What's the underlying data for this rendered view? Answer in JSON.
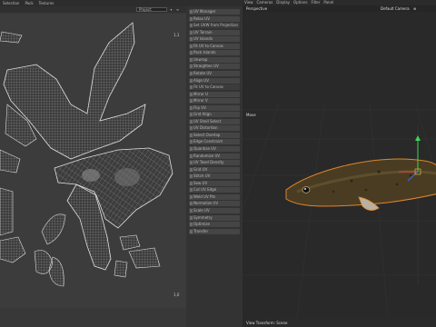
{
  "menubar": {
    "items": [
      "Selection",
      "Pack",
      "Textures"
    ]
  },
  "uv_editor": {
    "mode_dropdown": "Project",
    "corner_top_right": "1,1",
    "corner_bottom_right": "1,0"
  },
  "tools": [
    {
      "label": "UV Manager",
      "highlight": false
    },
    {
      "label": "Relax UV",
      "highlight": false
    },
    {
      "label": "Set UVW from Projection",
      "highlight": true
    },
    {
      "label": "UV Terrain",
      "highlight": false
    },
    {
      "label": "UV Islands",
      "highlight": false
    },
    {
      "label": "Fit UV to Canvas",
      "highlight": false
    },
    {
      "label": "Pack Islands",
      "highlight": false
    },
    {
      "label": "Unwrap",
      "highlight": false
    },
    {
      "label": "Straighten UV",
      "highlight": false
    },
    {
      "label": "Rotate UV",
      "highlight": false
    },
    {
      "label": "Align UV",
      "highlight": false
    },
    {
      "label": "Fit UV to Canvas",
      "highlight": true
    },
    {
      "label": "Mirror U",
      "highlight": false
    },
    {
      "label": "Mirror V",
      "highlight": false
    },
    {
      "label": "Flip UV",
      "highlight": false
    },
    {
      "label": "Grid Align",
      "highlight": false
    },
    {
      "label": "UV Shell Select",
      "highlight": false
    },
    {
      "label": "UV Distortion",
      "highlight": false
    },
    {
      "label": "Select Overlap",
      "highlight": false
    },
    {
      "label": "Edge Constraint",
      "highlight": false
    },
    {
      "label": "Quantize UV",
      "highlight": false
    },
    {
      "label": "Randomize UV",
      "highlight": false
    },
    {
      "label": "UV Texel Density",
      "highlight": false
    },
    {
      "label": "Grid UV",
      "highlight": false
    },
    {
      "label": "Stitch UV",
      "highlight": false
    },
    {
      "label": "Sew UV",
      "highlight": false
    },
    {
      "label": "Cut UV Edge",
      "highlight": false
    },
    {
      "label": "Weld UV Pts",
      "highlight": false
    },
    {
      "label": "Normalize UV",
      "highlight": false
    },
    {
      "label": "Scale UV",
      "highlight": false
    },
    {
      "label": "Symmetry",
      "highlight": false
    },
    {
      "label": "Optimize",
      "highlight": false
    },
    {
      "label": "Transfer",
      "highlight": false
    }
  ],
  "viewport": {
    "menu": [
      "View",
      "Cameras",
      "Display",
      "Options",
      "Filter",
      "Panel"
    ],
    "projection_label": "Perspective",
    "camera_label": "Default Camera",
    "move_label": "Move",
    "footer_label": "View Transform: Scene"
  },
  "colors": {
    "selection_outline": "#e0852a",
    "axis_y": "#3fd45a",
    "axis_x": "#e04040",
    "axis_z": "#3a70e0"
  }
}
